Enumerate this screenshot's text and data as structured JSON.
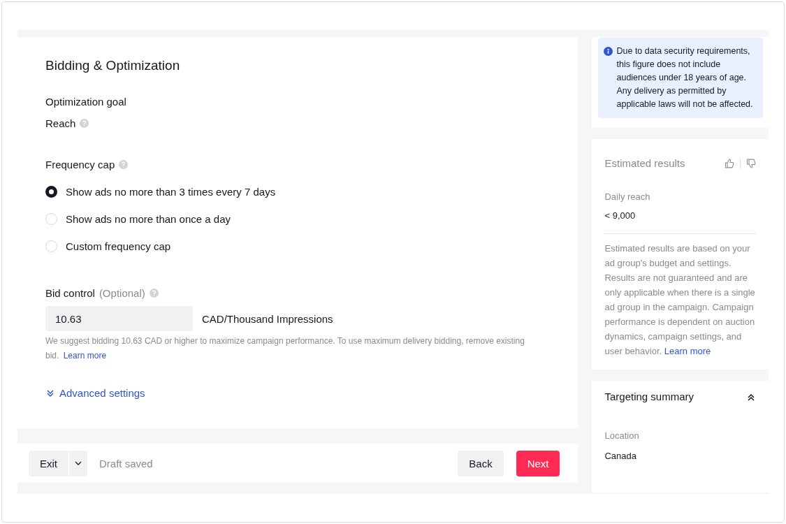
{
  "section": {
    "title": "Bidding & Optimization"
  },
  "optimization_goal": {
    "label": "Optimization goal",
    "value": "Reach"
  },
  "frequency_cap": {
    "label": "Frequency cap",
    "options": [
      {
        "label": "Show ads no more than 3 times every 7 days",
        "selected": true
      },
      {
        "label": "Show ads no more than once a day",
        "selected": false
      },
      {
        "label": "Custom frequency cap",
        "selected": false
      }
    ]
  },
  "bid_control": {
    "label": "Bid control",
    "optional": "(Optional)",
    "value": "10.63",
    "unit": "CAD/Thousand Impressions",
    "hint": "We suggest bidding 10.63 CAD or higher to maximize campaign performance. To use maximum delivery bidding, remove existing bid.",
    "link": "Learn more"
  },
  "advanced_settings": {
    "label": "Advanced settings",
    "expanded": false
  },
  "footer": {
    "exit": "Exit",
    "status": "Draft saved",
    "back": "Back",
    "next": "Next"
  },
  "notice": {
    "text": "Due to data security requirements, this figure does not include audiences under 18 years of age. Any delivery as permitted by applicable laws will not be affected."
  },
  "estimated_results": {
    "title": "Estimated results",
    "metric_label": "Daily reach",
    "metric_value": "< 9,000",
    "note": "Estimated results are based on your ad group's budget and settings. Results are not guaranteed and are only applicable when there is a single ad group in the campaign. Campaign performance is dependent on auction dynamics, campaign settings, and user behavior.",
    "link": "Learn more"
  },
  "targeting_summary": {
    "title": "Targeting summary",
    "expanded": true,
    "items": [
      {
        "label": "Location",
        "value": "Canada"
      }
    ]
  }
}
